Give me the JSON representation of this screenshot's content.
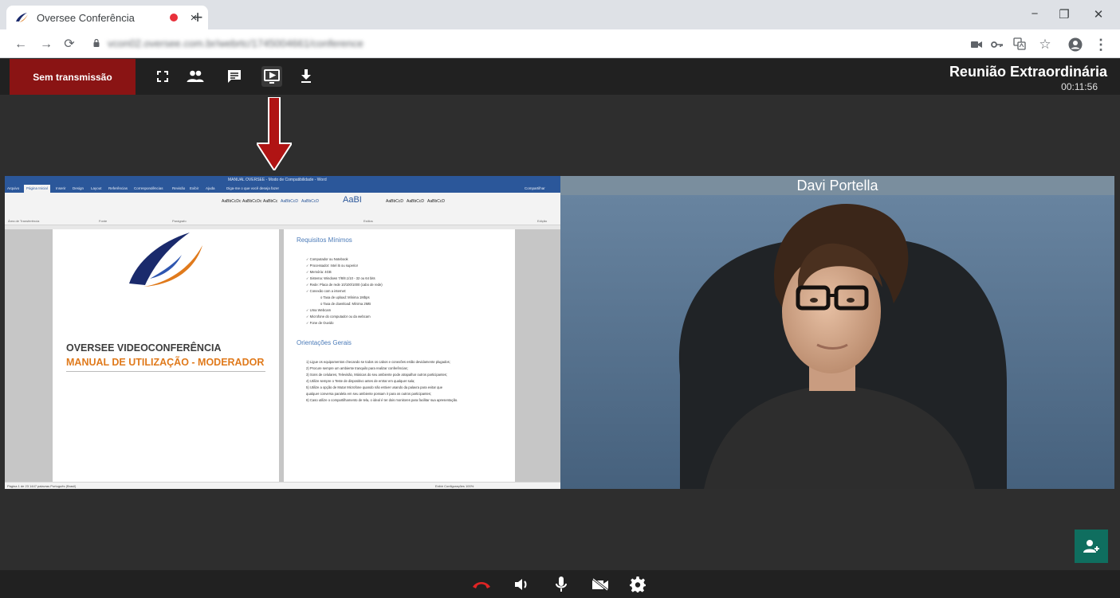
{
  "browser": {
    "tab_title": "Oversee Conferência",
    "tab_close": "×",
    "new_tab": "+",
    "url": "vcon02.oversee.com.br/webrtc/1745004661/conference",
    "window_controls": {
      "minimize": "−",
      "maximize": "❐",
      "close": "✕"
    },
    "nav": {
      "back": "←",
      "forward": "→",
      "reload": "⟳"
    },
    "extensions": {
      "bookmark": "☆",
      "menu": "⋮"
    }
  },
  "toolbar": {
    "transmission_label": "Sem transmissão",
    "meeting_title": "Reunião Extraordinária",
    "elapsed_time": "00:11:56"
  },
  "shared_screen": {
    "window_title": "MANUAL OVERSEE - Modo de Compatibilidade - Word",
    "ribbon_tabs": [
      "Arquivo",
      "Página Inicial",
      "Inserir",
      "Design",
      "Layout",
      "Referências",
      "Correspondências",
      "Revisão",
      "Exibir",
      "Ajuda",
      "Diga-me o que você deseja fazer",
      "Compartilhar"
    ],
    "ribbon_groups": [
      "Área de Transferência",
      "Fonte",
      "Parágrafo",
      "Estilos",
      "Edição"
    ],
    "styles": [
      "AaBbCcDc",
      "AaBbCcDc",
      "AaBbCc",
      "AaBbCcD",
      "AaBbCcD",
      "AaBI",
      "AaBbCcD",
      "AaBbCcD",
      "AaBbCcD"
    ],
    "status_left": "Página 1 de 23    1447 palavras    Português (Brasil)",
    "status_right": "Exibir Configurações    100%",
    "page1": {
      "title_line1": "OVERSEE VIDEOCONFERÊNCIA",
      "title_line2": "MANUAL DE UTILIZAÇÃO - MODERADOR"
    },
    "page2": {
      "heading1": "Requisitos Mínimos",
      "requirements": [
        "✓  Computador ou Notebook",
        "✓  Processador: Intel i5 ou superior",
        "✓  Memória: 4GB",
        "✓  Sistema: Windows 7/8/8.1/10 - 32 ou 64 bits",
        "✓  Rede: Placa de rede 10/100/1000 (cabo de rede)",
        "✓  Conexão com a internet:"
      ],
      "sub_requirements": [
        "o   Taxa de upload: Mínima 1Mbps",
        "o   Taxa de download: Mínima 2MB"
      ],
      "requirements_more": [
        "✓  Uma Webcam",
        "✓  Microfone do computador ou da webcam",
        "✓  Fone de Ouvido"
      ],
      "heading2": "Orientações Gerais",
      "guidelines": [
        "1)  Ligue os equipamentos checando se todos os cabos e conexões estão devidamente plugados;",
        "2)  Procure sempre um ambiente tranquilo para realizar conferências;",
        "3)  Sons de celulares, Televisão, Músicas do seu ambiente pode atrapalhar outros participantes;",
        "4)  Utilize sempre o Teste de dispositivo antes de entrar em qualquer sala;",
        "5)  Utilize a opção de Mutar Microfone quando não estiver usando da palavra para evitar que",
        "      qualquer conversa paralela em seu ambiente possam ir para os outros participantes;",
        "6)  Caso utilize o compartilhamento de tela, o ideal é ter dois monitores para facilitar sua apresentação."
      ]
    }
  },
  "participant": {
    "name": "Davi Portella"
  },
  "colors": {
    "transmission_button": "#8a1414",
    "arrow": "#b01414",
    "add_user_button": "#0f6e5f",
    "hangup": "#e02424",
    "word_blue": "#2b579a",
    "doc_orange": "#e07a1c"
  },
  "icons": {
    "toolbar": [
      "fullscreen-icon",
      "participants-icon",
      "chat-icon",
      "screen-share-icon",
      "download-icon"
    ],
    "controls": [
      "hangup-icon",
      "volume-icon",
      "microphone-icon",
      "camera-off-icon",
      "settings-icon"
    ],
    "add_participant": "add-person-icon"
  }
}
